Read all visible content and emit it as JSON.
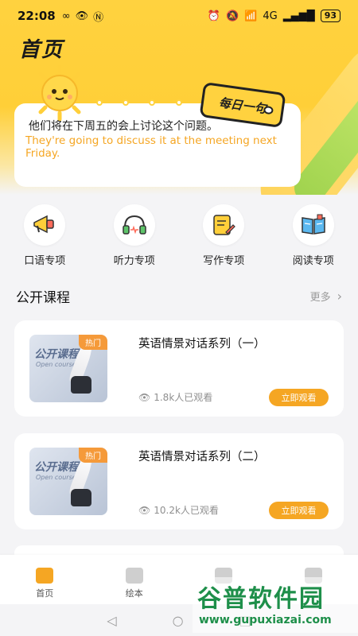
{
  "status_bar": {
    "time": "22:08",
    "battery": "93",
    "signal_text": "4G"
  },
  "header": {
    "title": "首页"
  },
  "daily_sentence": {
    "tag": "每日一句",
    "chinese": "他们将在下周五的会上讨论这个问题。",
    "english": "They're going to discuss it at the meeting next Friday."
  },
  "quick_entries": [
    {
      "label": "口语专项",
      "icon": "megaphone-icon"
    },
    {
      "label": "听力专项",
      "icon": "headphones-icon"
    },
    {
      "label": "写作专项",
      "icon": "notepad-pen-icon"
    },
    {
      "label": "阅读专项",
      "icon": "open-book-icon"
    }
  ],
  "courses_section": {
    "title": "公开课程",
    "more_label": "更多",
    "courses": [
      {
        "title": "英语情景对话系列（一）",
        "badge": "热门",
        "thumb_word": "公开课程",
        "thumb_sub": "Open courses",
        "views": "1.8k人已观看",
        "button": "立即观看"
      },
      {
        "title": "英语情景对话系列（二）",
        "badge": "热门",
        "thumb_word": "公开课程",
        "thumb_sub": "Open courses",
        "views": "10.2k人已观看",
        "button": "立即观看"
      }
    ]
  },
  "bottom_nav": {
    "items": [
      {
        "label": "首页",
        "active": true
      },
      {
        "label": "绘本",
        "active": false
      },
      {
        "label": "",
        "active": false
      },
      {
        "label": "",
        "active": false
      }
    ]
  },
  "watermark": {
    "main": "谷普软件园",
    "sub": "www.gupuxiazai.com"
  },
  "colors": {
    "brand_yellow": "#ffd23f",
    "accent_orange": "#f5a623",
    "watermark_green": "#1e8f4a"
  }
}
